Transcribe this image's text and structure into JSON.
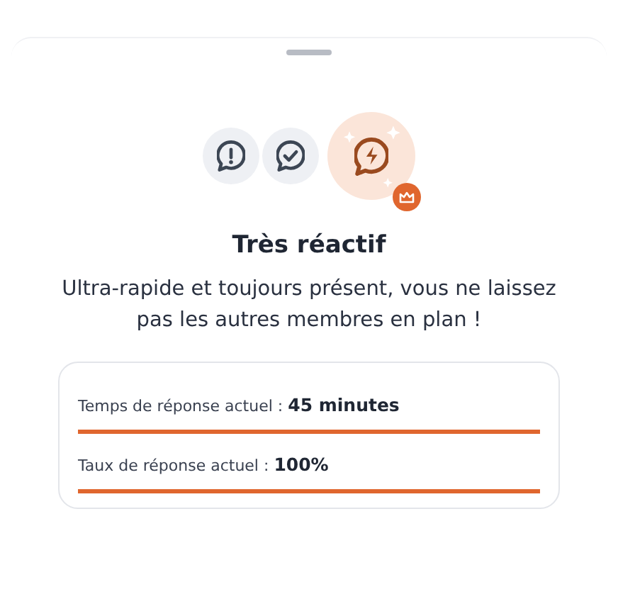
{
  "badges": [
    {
      "kind": "alert",
      "selected": false
    },
    {
      "kind": "check",
      "selected": false
    },
    {
      "kind": "bolt",
      "selected": true
    }
  ],
  "title": "Très réactif",
  "description": "Ultra-rapide et toujours présent, vous ne laissez pas les autres membres en plan !",
  "stats": [
    {
      "text": "Temps de réponse actuel : **45 minutes**",
      "level": 1
    },
    {
      "text": "Taux de réponse actuel : **100%**",
      "level": 1
    }
  ]
}
